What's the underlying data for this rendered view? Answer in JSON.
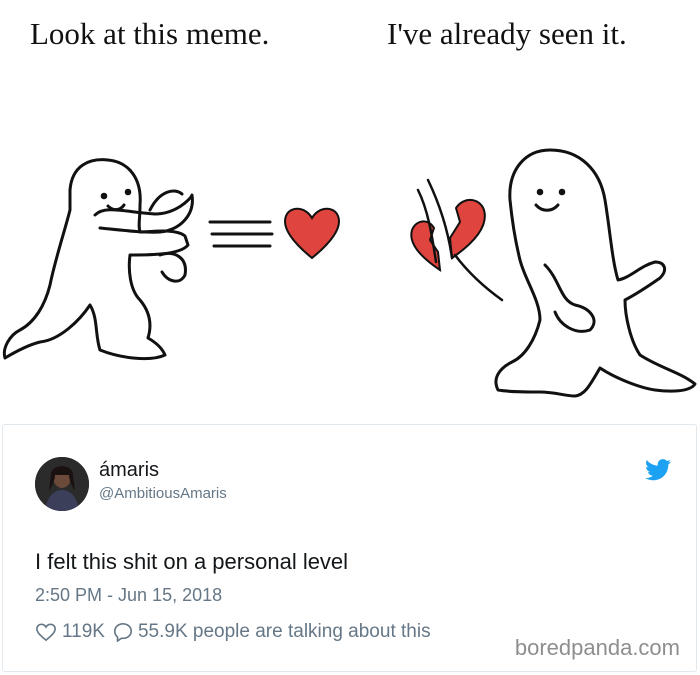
{
  "meme": {
    "caption_left": "Look at this meme.",
    "caption_right": "I've already seen it."
  },
  "tweet": {
    "author_name": "ámaris",
    "handle": "@AmbitiousAmaris",
    "text": "I felt this shit on a personal level",
    "timestamp": "2:50 PM - Jun 15, 2018",
    "likes": "119K",
    "replies": "55.9K people are talking about this",
    "icons": [
      "twitter-bird-icon",
      "heart-outline-icon",
      "speech-bubble-icon"
    ],
    "colors": {
      "twitter_blue": "#1da1f2",
      "secondary_text": "#657786",
      "primary_text": "#14171a"
    }
  },
  "watermark": "boredpanda.com",
  "colors": {
    "heart_red": "#e0443e"
  }
}
